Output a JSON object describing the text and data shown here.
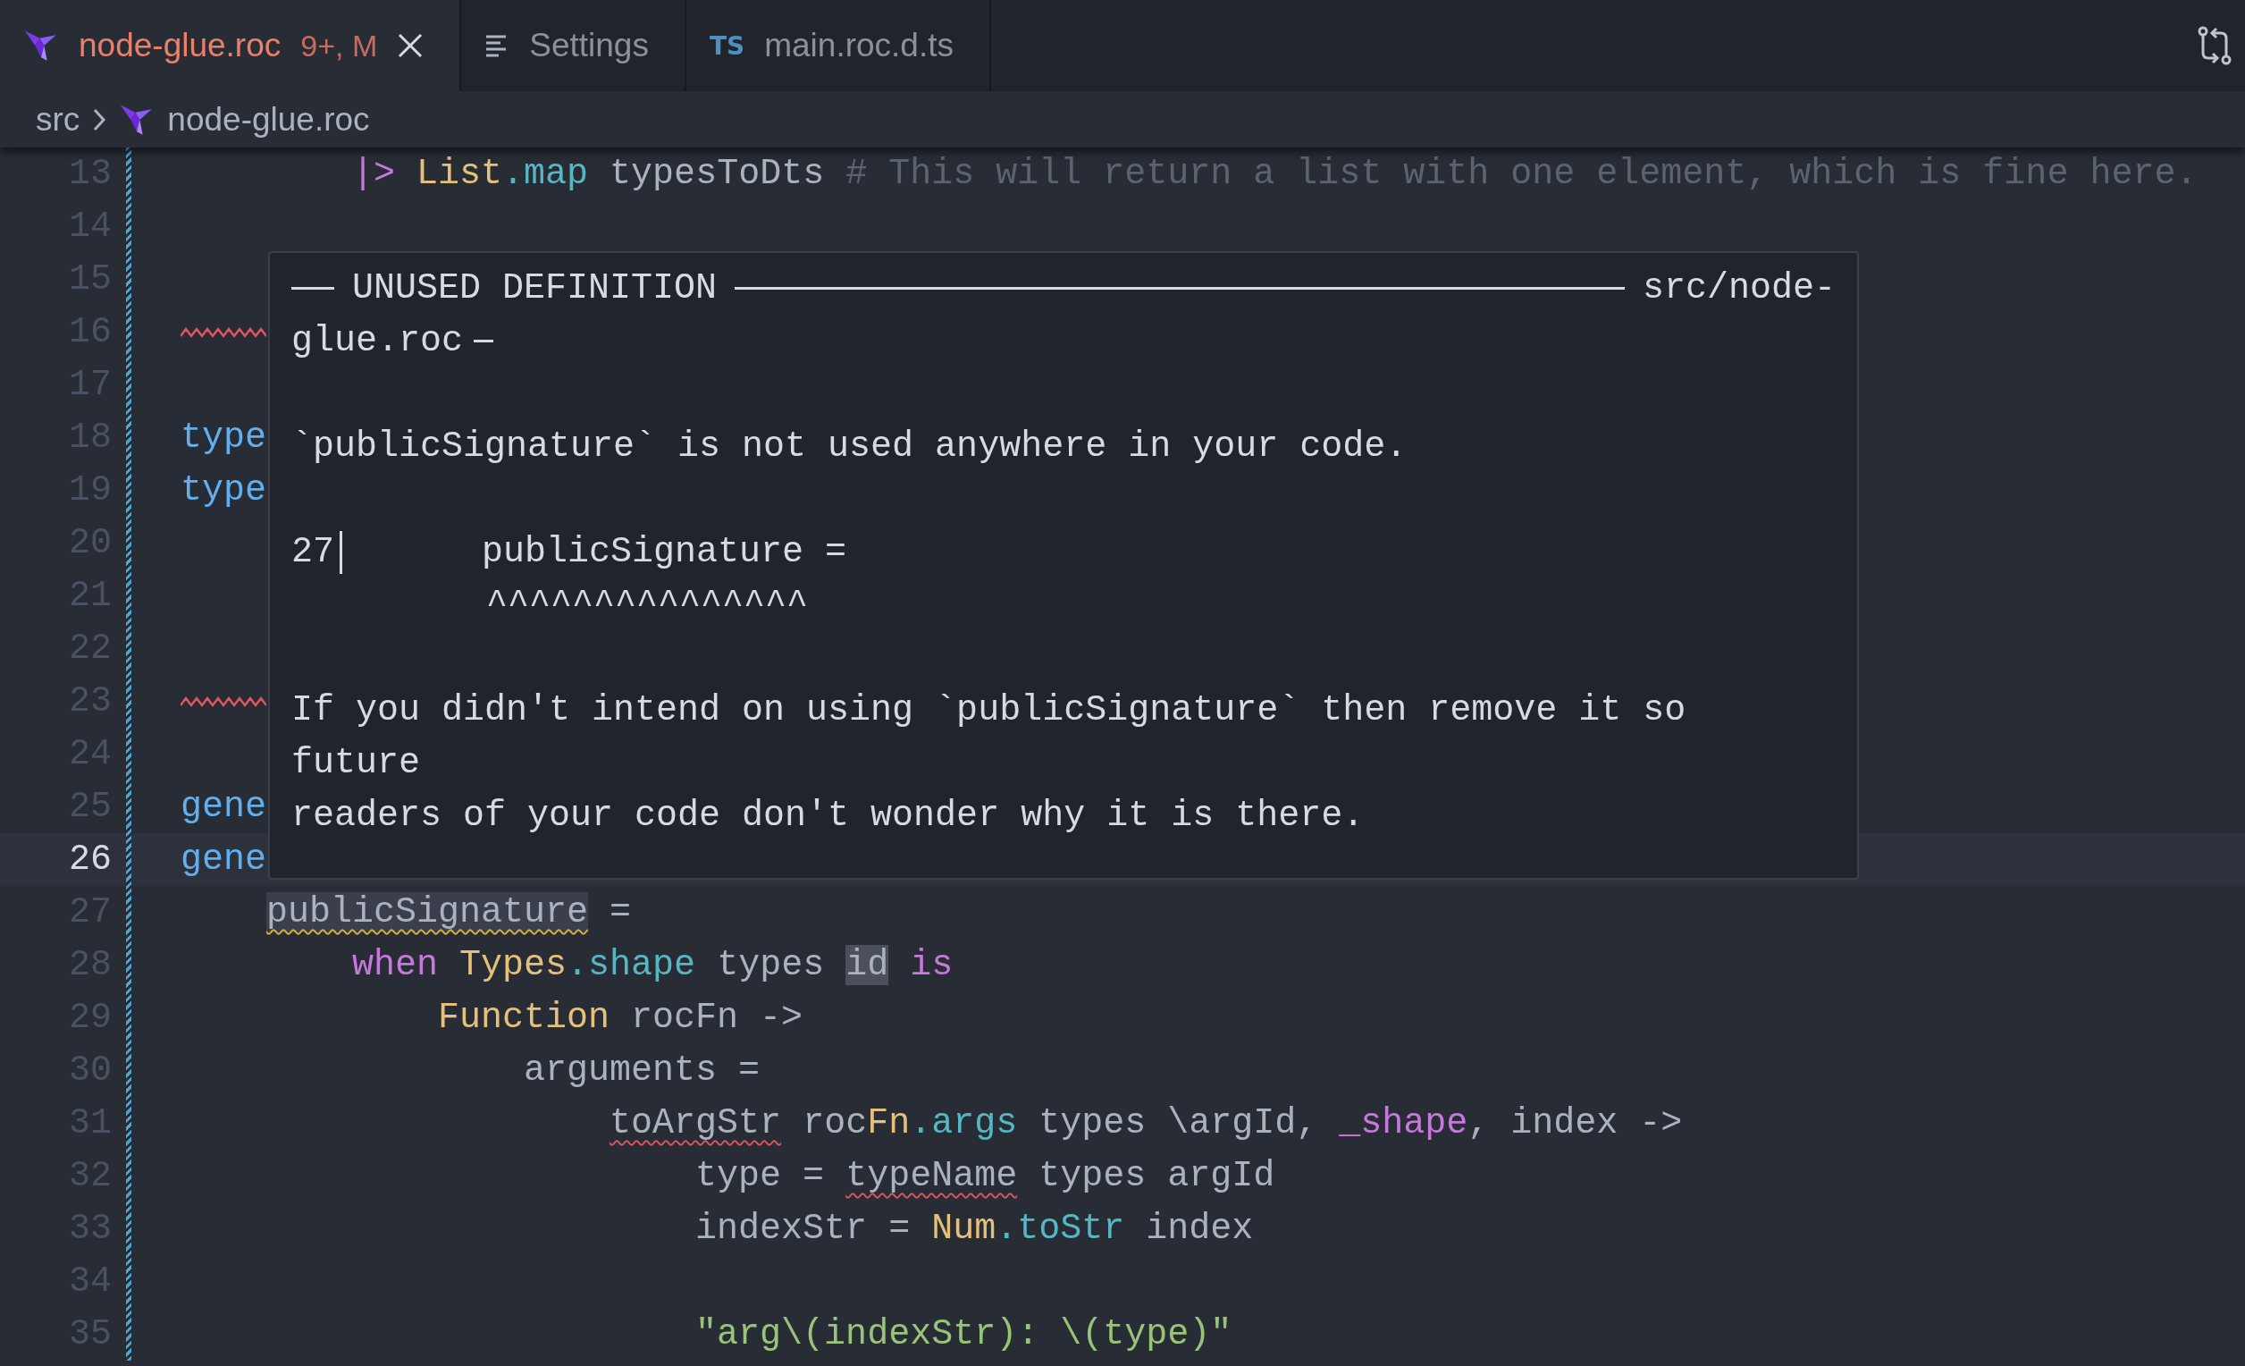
{
  "tabs": [
    {
      "label": "node-glue.roc",
      "kind": "roc-file",
      "badge": "9+, M",
      "has_errors": true,
      "selected": true
    },
    {
      "label": "Settings",
      "kind": "settings",
      "has_errors": false,
      "selected": false
    },
    {
      "label": "main.roc.d.ts",
      "kind": "ts-file",
      "icon_text": "TS",
      "has_errors": false,
      "selected": false
    }
  ],
  "breadcrumb": [
    {
      "label": "src",
      "kind": "folder"
    },
    {
      "label": "node-glue.roc",
      "kind": "roc-file"
    }
  ],
  "lines": [
    {
      "number": "13",
      "tokens": [
        {
          "text": "        |>",
          "kind": "keyword"
        },
        {
          "text": " List",
          "kind": "type"
        },
        {
          "text": ".map",
          "kind": "func"
        },
        {
          "text": " typesToDts ",
          "kind": "plain"
        },
        {
          "text": "# This will return a list with one element, which is fine here.",
          "kind": "comment"
        }
      ]
    },
    {
      "number": "14"
    },
    {
      "number": "15"
    },
    {
      "number": "16",
      "error_squiggle": true
    },
    {
      "number": "17"
    },
    {
      "number": "18",
      "tokens": [
        {
          "text": "type",
          "kind": "name"
        }
      ]
    },
    {
      "number": "19",
      "tokens": [
        {
          "text": "type",
          "kind": "name"
        }
      ]
    },
    {
      "number": "20"
    },
    {
      "number": "21"
    },
    {
      "number": "22"
    },
    {
      "number": "23",
      "error_squiggle": true
    },
    {
      "number": "24"
    },
    {
      "number": "25",
      "tokens": [
        {
          "text": "gene",
          "kind": "name"
        }
      ]
    },
    {
      "number": "26",
      "current": true,
      "tokens": [
        {
          "text": "gene",
          "kind": "name"
        }
      ]
    },
    {
      "number": "27",
      "tokens": [
        {
          "text": "    publicSignature",
          "kind": "plain",
          "warning": true,
          "selected": true
        },
        {
          "text": " =",
          "kind": "plain"
        }
      ]
    },
    {
      "number": "28",
      "tokens": [
        {
          "text": "        when",
          "kind": "keyword"
        },
        {
          "text": " Types",
          "kind": "type"
        },
        {
          "text": ".shape",
          "kind": "func"
        },
        {
          "text": " types ",
          "kind": "plain"
        },
        {
          "text": "id",
          "kind": "plain",
          "highlighted": true
        },
        {
          "text": " is",
          "kind": "keyword"
        }
      ]
    },
    {
      "number": "29",
      "tokens": [
        {
          "text": "            Function",
          "kind": "type"
        },
        {
          "text": " rocFn ->",
          "kind": "plain"
        }
      ]
    },
    {
      "number": "30",
      "tokens": [
        {
          "text": "                arguments =",
          "kind": "plain"
        }
      ]
    },
    {
      "number": "31",
      "tokens": [
        {
          "text": "                    toArgStr",
          "kind": "plain",
          "error": true
        },
        {
          "text": " roc",
          "kind": "plain"
        },
        {
          "text": "Fn",
          "kind": "type"
        },
        {
          "text": ".args",
          "kind": "func"
        },
        {
          "text": " types \\argId, ",
          "kind": "plain"
        },
        {
          "text": "_shape",
          "kind": "keyword"
        },
        {
          "text": ", index ->",
          "kind": "plain"
        }
      ]
    },
    {
      "number": "32",
      "tokens": [
        {
          "text": "                        type = ",
          "kind": "plain"
        },
        {
          "text": "typeName",
          "kind": "plain",
          "error": true
        },
        {
          "text": " types argId",
          "kind": "plain"
        }
      ]
    },
    {
      "number": "33",
      "tokens": [
        {
          "text": "                        indexStr = ",
          "kind": "plain"
        },
        {
          "text": "Num",
          "kind": "type"
        },
        {
          "text": ".toStr",
          "kind": "func"
        },
        {
          "text": " index",
          "kind": "plain"
        }
      ]
    },
    {
      "number": "34"
    },
    {
      "number": "35",
      "tokens": [
        {
          "text": "                        \"arg\\(indexStr): \\(type)\"",
          "kind": "string"
        }
      ]
    }
  ],
  "hover": {
    "title": "UNUSED DEFINITION",
    "path_parts": [
      "src/node-",
      "glue.roc"
    ],
    "message": "`publicSignature` is not used anywhere in your code.",
    "snippet": {
      "line_number": "27",
      "code": "publicSignature =",
      "marker": "^^^^^^^^^^^^^^^"
    },
    "hint_lines": [
      "If you didn't intend on using `publicSignature` then remove it so",
      "future",
      "readers of your code don't wonder why it is there."
    ]
  }
}
